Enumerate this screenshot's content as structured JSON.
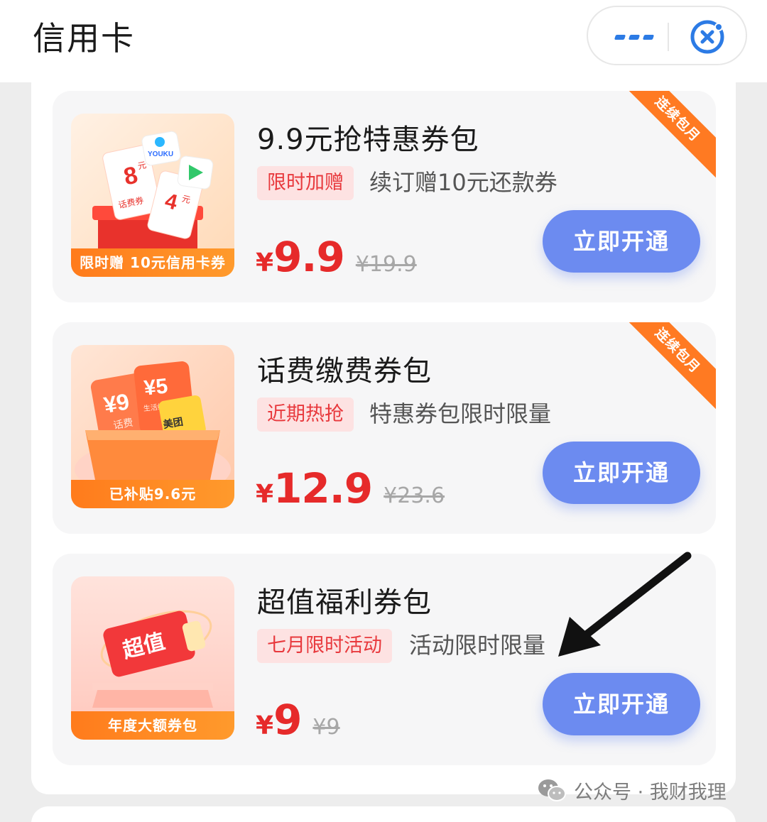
{
  "header": {
    "title": "信用卡"
  },
  "cards": [
    {
      "name": "9.9元抢特惠券包",
      "tag": "限时加赠",
      "subtitle": "续订赠10元还款券",
      "currency": "¥",
      "price": "9.9",
      "original_price": "¥19.9",
      "ribbon": "连续包月",
      "thumb_strip": "限时赠 10元信用卡券",
      "thumb_text": [
        "8",
        "元",
        "话费券",
        "4",
        "元",
        "YOUKU"
      ],
      "button": "立即开通"
    },
    {
      "name": "话费缴费券包",
      "tag": "近期热抢",
      "subtitle": "特惠券包限时限量",
      "currency": "¥",
      "price": "12.9",
      "original_price": "¥23.6",
      "ribbon": "连续包月",
      "thumb_strip": "已补贴9.6元",
      "thumb_text": [
        "¥9",
        "¥5",
        "话费",
        "生活缴费券",
        "美团"
      ],
      "button": "立即开通"
    },
    {
      "name": "超值福利券包",
      "tag": "七月限时活动",
      "subtitle": "活动限时限量",
      "currency": "¥",
      "price": "9",
      "original_price": "¥9",
      "thumb_strip": "年度大额券包",
      "thumb_text": [
        "超值"
      ],
      "button": "立即开通"
    }
  ],
  "watermark": "公众号 · 我财我理",
  "colors": {
    "accent": "#6c8bf0",
    "price": "#e62a2a",
    "ribbon": "#ff7a22",
    "tag_bg": "#fde2e2"
  }
}
